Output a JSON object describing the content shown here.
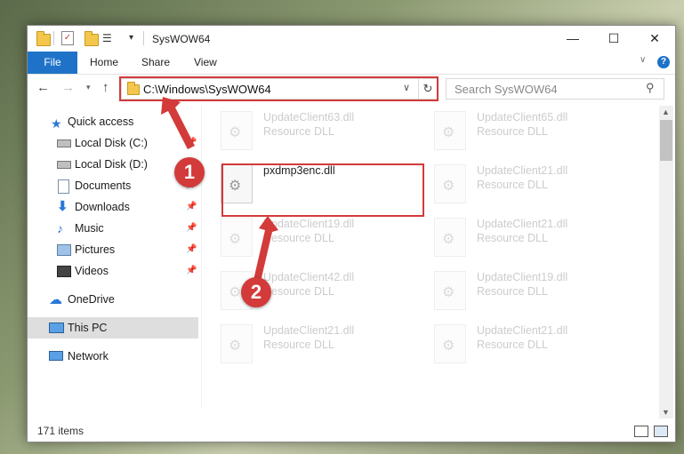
{
  "window": {
    "title": "SysWOW64",
    "controls": {
      "minimize": "—",
      "maximize": "☐",
      "close": "✕"
    }
  },
  "ribbon": {
    "tabs": [
      {
        "label": "File",
        "active": true
      },
      {
        "label": "Home"
      },
      {
        "label": "Share"
      },
      {
        "label": "View"
      }
    ],
    "help": "?"
  },
  "address": {
    "path": "C:\\Windows\\SysWOW64"
  },
  "search": {
    "placeholder": "Search SysWOW64"
  },
  "sidebar": {
    "items": [
      {
        "label": "Quick access",
        "icon": "star-icon"
      },
      {
        "label": "Local Disk (C:)",
        "icon": "drive-icon",
        "pinned": true
      },
      {
        "label": "Local Disk (D:)",
        "icon": "drive-icon"
      },
      {
        "label": "Documents",
        "icon": "documents-icon",
        "pinned": true
      },
      {
        "label": "Downloads",
        "icon": "download-icon",
        "pinned": true
      },
      {
        "label": "Music",
        "icon": "music-icon",
        "pinned": true
      },
      {
        "label": "Pictures",
        "icon": "pictures-icon",
        "pinned": true
      },
      {
        "label": "Videos",
        "icon": "videos-icon",
        "pinned": true
      },
      {
        "label": "OneDrive",
        "icon": "cloud-icon"
      },
      {
        "label": "This PC",
        "icon": "computer-icon",
        "selected": true
      },
      {
        "label": "Network",
        "icon": "network-icon"
      }
    ]
  },
  "files": [
    {
      "name": "UpdateClient63.dll",
      "type": "Resource DLL",
      "faded": true
    },
    {
      "name": "UpdateClient65.dll",
      "type": "Resource DLL",
      "faded": true
    },
    {
      "name": "pxdmp3enc.dll",
      "type": "",
      "faded": false
    },
    {
      "name": "UpdateClient21.dll",
      "type": "Resource DLL",
      "faded": true
    },
    {
      "name": "UpdateClient19.dll",
      "type": "Resource DLL",
      "faded": true
    },
    {
      "name": "UpdateClient21.dll",
      "type": "Resource DLL",
      "faded": true
    },
    {
      "name": "UpdateClient42.dll",
      "type": "Resource DLL",
      "faded": true
    },
    {
      "name": "UpdateClient19.dll",
      "type": "Resource DLL",
      "faded": true
    },
    {
      "name": "UpdateClient21.dll",
      "type": "Resource DLL",
      "faded": true
    },
    {
      "name": "UpdateClient21.dll",
      "type": "Resource DLL",
      "faded": true
    }
  ],
  "status": {
    "item_count": "171 items"
  },
  "annotations": {
    "step1": "1",
    "step2": "2",
    "color": "#d33a3a"
  }
}
